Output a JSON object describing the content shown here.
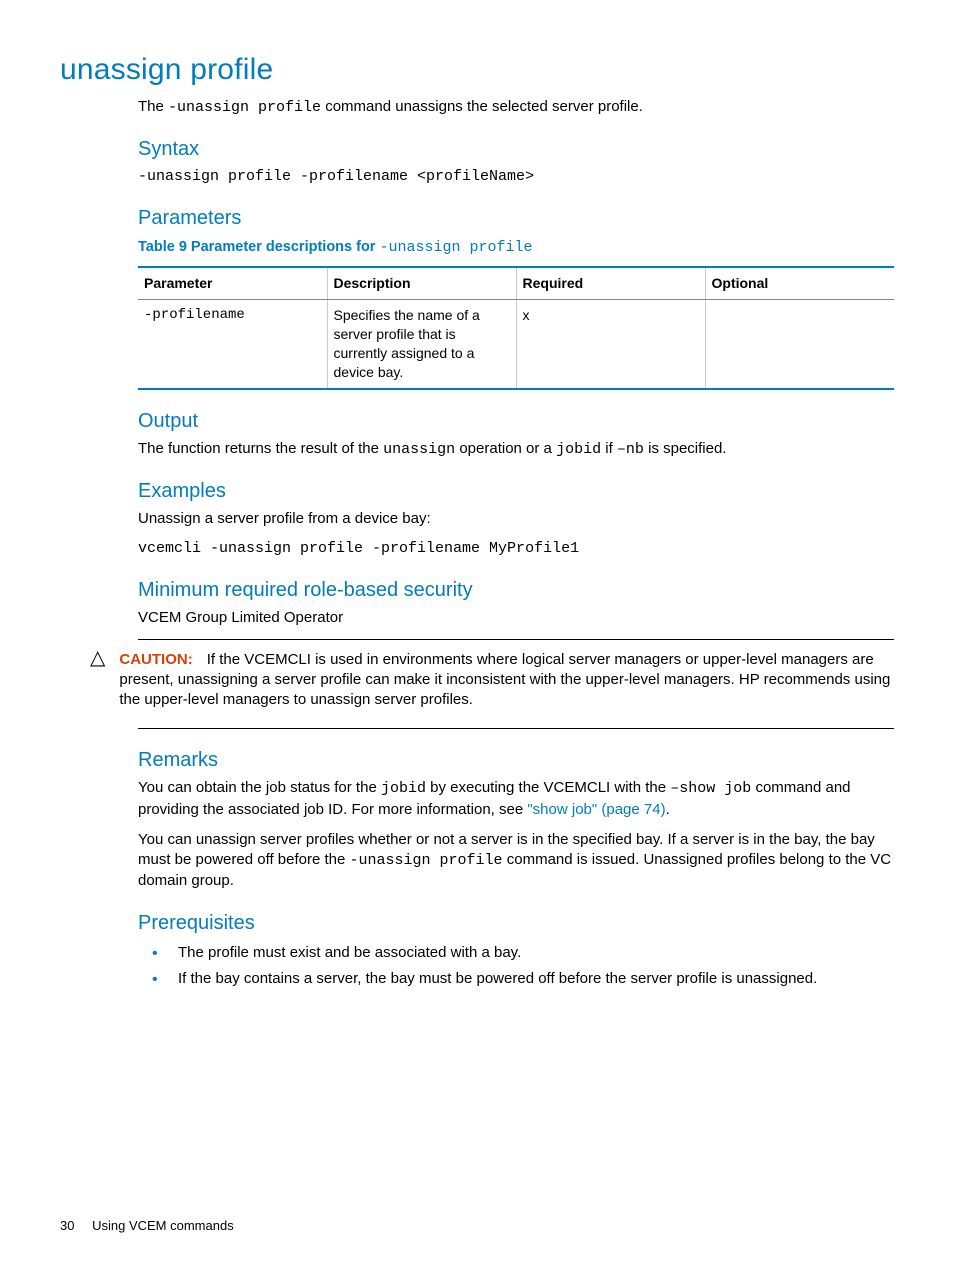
{
  "title": "unassign profile",
  "intro": {
    "pre": "The ",
    "code": "-unassign profile",
    "post": " command unassigns the selected server profile."
  },
  "syntax": {
    "heading": "Syntax",
    "line": "-unassign profile -profilename <profileName>"
  },
  "parameters": {
    "heading": "Parameters",
    "caption_pre": "Table 9 Parameter descriptions for ",
    "caption_code": "-unassign profile",
    "headers": {
      "c1": "Parameter",
      "c2": "Description",
      "c3": "Required",
      "c4": "Optional"
    },
    "rows": [
      {
        "param": "-profilename",
        "desc": "Specifies the name of a server profile that is currently assigned to a device bay.",
        "req": "x",
        "opt": ""
      }
    ]
  },
  "output": {
    "heading": "Output",
    "t1": "The function returns the result of the ",
    "c1": "unassign",
    "t2": " operation or a ",
    "c2": "jobid",
    "t3": " if ",
    "c3": "–nb",
    "t4": " is specified."
  },
  "examples": {
    "heading": "Examples",
    "lead": "Unassign a server profile from a device bay:",
    "cmd": "vcemcli -unassign profile -profilename MyProfile1"
  },
  "security": {
    "heading": "Minimum required role-based security",
    "text": "VCEM Group Limited Operator"
  },
  "caution": {
    "label": "CAUTION:",
    "text": "If the VCEMCLI is used in environments where logical server managers or upper-level managers are present, unassigning a server profile can make it inconsistent with the upper-level managers. HP recommends using the upper-level managers to unassign server profiles."
  },
  "remarks": {
    "heading": "Remarks",
    "p1": {
      "t1": "You can obtain the job status for the ",
      "c1": "jobid",
      "t2": " by executing the VCEMCLI with the ",
      "c2": "–show job",
      "t3": " command and providing the associated job ID. For more information, see ",
      "link": "\"show job\" (page 74)",
      "t4": "."
    },
    "p2": {
      "t1": "You can unassign server profiles whether or not a server is in the specified bay. If a server is in the bay, the bay must be powered off before the ",
      "c1": "-unassign profile",
      "t2": " command is issued. Unassigned profiles belong to the VC domain group."
    }
  },
  "prereq": {
    "heading": "Prerequisites",
    "items": [
      "The profile must exist and be associated with a bay.",
      "If the bay contains a server, the bay must be powered off before the server profile is unassigned."
    ]
  },
  "footer": {
    "page": "30",
    "section": "Using VCEM commands"
  }
}
